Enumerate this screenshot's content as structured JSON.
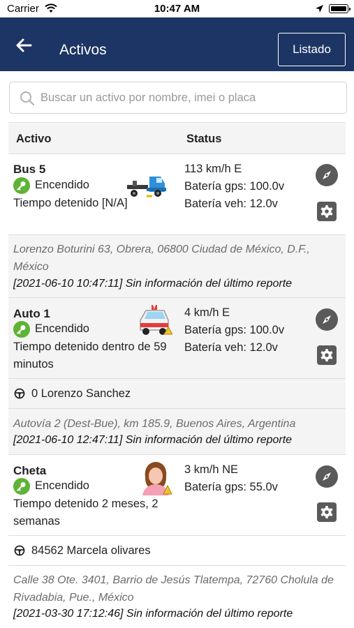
{
  "status_bar": {
    "carrier": "Carrier",
    "time": "10:47 AM"
  },
  "nav": {
    "title": "Activos",
    "listado_label": "Listado"
  },
  "search": {
    "placeholder": "Buscar un activo por nombre, imei o placa"
  },
  "table": {
    "col_activo": "Activo",
    "col_status": "Status"
  },
  "assets": [
    {
      "name": "Bus 5",
      "state": "Encendido",
      "stopped": "Tiempo detenido [N/A]",
      "image": "tow-truck-icon",
      "status_lines": [
        "113 km/h E",
        "Batería gps: 100.0v",
        "Batería veh: 12.0v"
      ],
      "driver": "",
      "address": "Lorenzo Boturini 63, Obrera, 06800 Ciudad de México, D.F., México",
      "report": "[2021-06-10 10:47:11] Sin información del último reporte"
    },
    {
      "name": "Auto 1",
      "state": "Encendido",
      "stopped": "Tiempo detenido dentro de 59 minutos",
      "image": "ambulance-icon",
      "status_lines": [
        "4 km/h E",
        "Batería gps: 100.0v",
        "Batería veh: 12.0v"
      ],
      "driver": "0 Lorenzo Sanchez",
      "address": "Autovía 2 (Dest-Bue), km 185.9, Buenos Aires, Argentina",
      "report": "[2021-06-10 12:47:11] Sin información del último reporte"
    },
    {
      "name": "Cheta",
      "state": "Encendido",
      "stopped": "Tiempo detenido 2 meses, 2 semanas",
      "image": "woman-avatar-icon",
      "status_lines": [
        "3 km/h NE",
        "Batería gps: 55.0v"
      ],
      "driver": "84562 Marcela olivares",
      "address": "Calle 38 Ote. 3401, Barrio de Jesús Tlatempa, 72760 Cholula de Rivadabia, Pue., México",
      "report": "[2021-03-30 17:12:46] Sin información del último reporte"
    }
  ],
  "colors": {
    "navbar": "#1c3564",
    "key_green": "#5fb335",
    "action_grey": "#5a5a5a",
    "row_alt": "#f4f4f4"
  }
}
